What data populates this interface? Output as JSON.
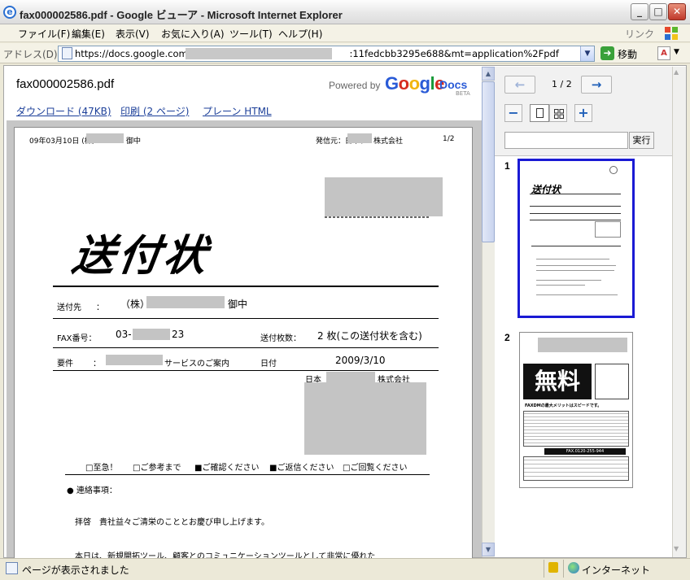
{
  "window": {
    "title": "fax000002586.pdf - Google ビューア - Microsoft Internet Explorer",
    "minimize_glyph": "_",
    "maximize_glyph": "□",
    "close_glyph": "✕"
  },
  "menu": {
    "items": [
      "ファイル(F)",
      "編集(E)",
      "表示(V)",
      "お気に入り(A)",
      "ツール(T)",
      "ヘルプ(H)"
    ],
    "links_label": "リンク"
  },
  "address": {
    "label": "アドレス(D)",
    "url_prefix": "https://docs.google.com/a/",
    "url_suffix": ":11fedcbb3295e688&mt=application%2Fpdf",
    "go_label": "移動"
  },
  "viewer": {
    "doc_title": "fax000002586.pdf",
    "powered_by": "Powered by",
    "logo_google": [
      "G",
      "o",
      "o",
      "g",
      "l",
      "e"
    ],
    "logo_docs": "Docs",
    "logo_beta": "BETA",
    "download_link": "ダウンロード (47KB)",
    "print_link": "印刷 (2 ページ)",
    "plain_html_link": "プレーン HTML",
    "page_indicator": "1 / 2",
    "prev_icon": "←",
    "next_icon": "→",
    "zoom_out": "−",
    "zoom_in": "+",
    "search_button": "実行",
    "search_placeholder": "",
    "thumb_labels": [
      "1",
      "2"
    ]
  },
  "fax": {
    "date_line": "09年03月10日 (株)",
    "recipient_suffix": "御中",
    "sender": "発信元：日本テ",
    "sender_suffix": "株式会社",
    "page_of": "1/2",
    "heading": "送付状",
    "to_label": "送付先",
    "colon": "：",
    "to_company": "（株）",
    "to_honorific": "御中",
    "fax_label": "FAX番号：",
    "fax_prefix": "03-",
    "fax_suffix": "23",
    "count_label": "送付枚数：",
    "count_value": "2 枚(この送付状を含む)",
    "subject_label": "要件",
    "subject_value": "サービスのご案内",
    "date_label": "日付",
    "date_value": "2009/3/10",
    "company_prefix": "日本",
    "company_suffix": "株式会社",
    "checks": [
      "□至急！",
      "□ご参考まで",
      "■ご確認ください",
      "■ご返信ください",
      "□ご回覧ください"
    ],
    "notes_heading": "● 連絡事項：",
    "body_line1": "拝啓　貴社益々ご清栄のこととお慶び申し上げます。",
    "body_line2": "本日は、新規開拓ツール、顧客とのコミュニケーションツールとして非常に優れた"
  },
  "thumb2": {
    "big_text": "無料",
    "headline": "FAXDMの最大メリットはスピードです。",
    "fax_number": "FAX.0120-255-944"
  },
  "status": {
    "text": "ページが表示されました",
    "zone": "インターネット"
  },
  "colors": {
    "link": "#1c3f99",
    "thumb_selected": "#1a1ad4",
    "redaction": "#c4c4c4"
  }
}
